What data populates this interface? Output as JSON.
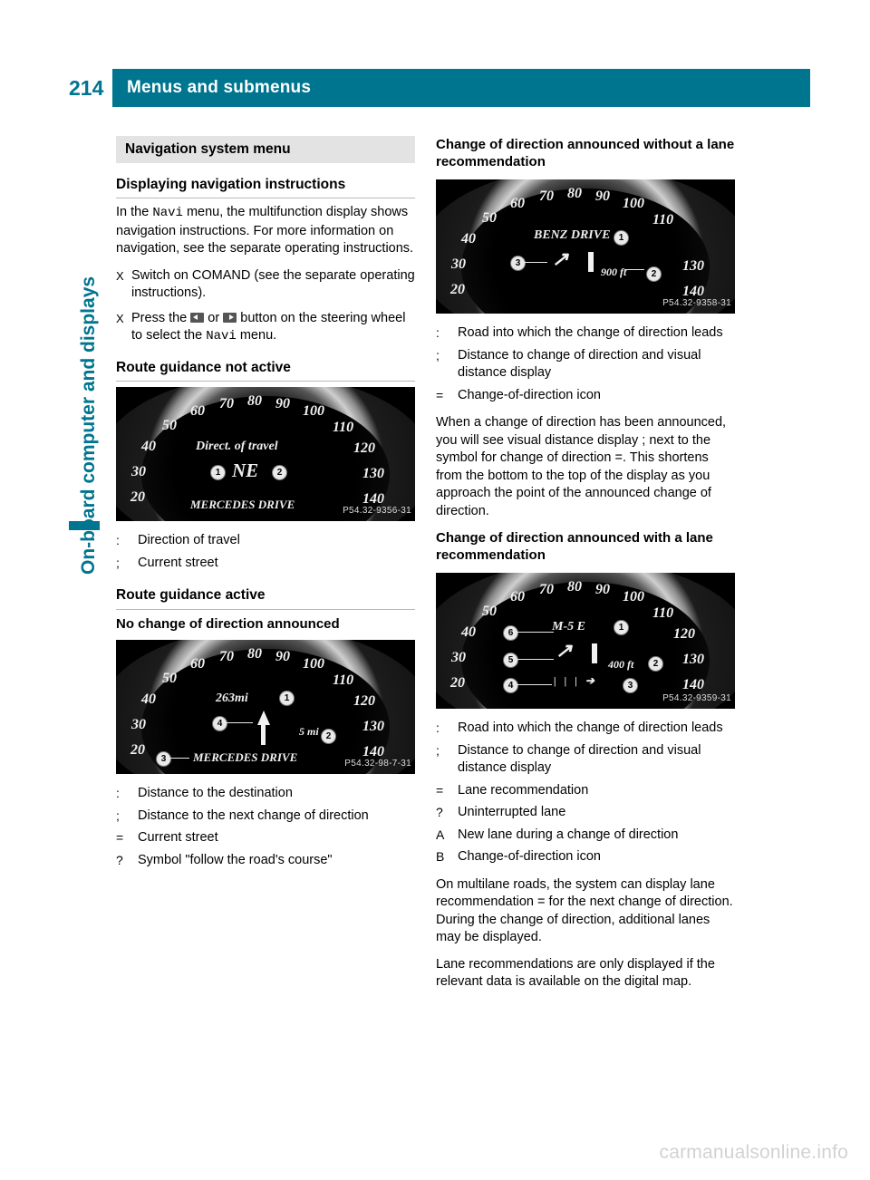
{
  "header": {
    "page_number": "214",
    "title": "Menus and submenus",
    "accent_color": "#00758f"
  },
  "side_tab": {
    "label": "On-board computer and displays"
  },
  "left_column": {
    "section_band": "Navigation system menu",
    "heading_1": "Displaying navigation instructions",
    "paragraph_1_pre": "In the ",
    "paragraph_1_mono": "Navi",
    "paragraph_1_post": " menu, the multifunction display shows navigation instructions. For more information on navigation, see the separate operating instructions.",
    "steps": [
      {
        "marker": "X",
        "text": "Switch on COMAND (see the separate operating instructions)."
      }
    ],
    "step_2_pre": "Press the ",
    "step_2_or": " or ",
    "step_2_mid": " button on the steering wheel to select the ",
    "step_2_mono": "Navi",
    "step_2_post": " menu.",
    "heading_2": "Route guidance not active",
    "figure_1": {
      "name": "instrument-cluster-direction-of-travel",
      "lcd_title": "Direct. of travel",
      "lcd_value": "NE",
      "lcd_street": "MERCEDES DRIVE",
      "part_code": "P54.32-9356-31",
      "ticks": [
        "20",
        "30",
        "40",
        "50",
        "60",
        "70",
        "80",
        "90",
        "100",
        "110",
        "120",
        "130",
        "140"
      ],
      "callouts": [
        "1",
        "2"
      ]
    },
    "legend_1": [
      {
        "marker": "1",
        "text": "Direction of travel"
      },
      {
        "marker": "2",
        "text": "Current street"
      }
    ],
    "heading_3": "Route guidance active",
    "heading_4": "No change of direction announced",
    "figure_2": {
      "name": "instrument-cluster-no-change-of-direction",
      "lcd_distance_total": "263mi",
      "lcd_distance_next": "5 mi",
      "lcd_street": "MERCEDES DRIVE",
      "part_code": "P54.32-98-7-31",
      "ticks": [
        "20",
        "30",
        "40",
        "50",
        "60",
        "70",
        "80",
        "90",
        "100",
        "110",
        "120",
        "130",
        "140"
      ],
      "callouts": [
        "1",
        "2",
        "3",
        "4"
      ]
    },
    "legend_2": [
      {
        "marker": "1",
        "text": "Distance to the destination"
      },
      {
        "marker": "2",
        "text": "Distance to the next change of direction"
      },
      {
        "marker": "3",
        "text": "Current street"
      },
      {
        "marker": "4",
        "text": "Symbol \"follow the road's course\""
      }
    ]
  },
  "right_column": {
    "heading_1": "Change of direction announced without a lane recommendation",
    "figure_3": {
      "name": "instrument-cluster-change-without-lane",
      "lcd_street": "BENZ DRIVE",
      "lcd_distance": "900 ft",
      "part_code": "P54.32-9358-31",
      "ticks": [
        "20",
        "30",
        "40",
        "50",
        "60",
        "70",
        "80",
        "90",
        "100",
        "110",
        "130",
        "140"
      ],
      "callouts": [
        "1",
        "2",
        "3"
      ]
    },
    "legend_1": [
      {
        "marker": "1",
        "text": "Road into which the change of direction leads"
      },
      {
        "marker": "2",
        "text": "Distance to change of direction and visual distance display"
      },
      {
        "marker": "3",
        "text": "Change-of-direction icon"
      }
    ],
    "paragraph_1_a": "When a change of direction has been announced, you will see visual distance display ",
    "paragraph_1_b": " next to the symbol for change of direction ",
    "paragraph_1_c": ". This shortens from the bottom to the top of the display as you approach the point of the announced change of direction.",
    "heading_2": "Change of direction announced with a lane recommendation",
    "figure_4": {
      "name": "instrument-cluster-change-with-lane",
      "lcd_street": "M-5 E",
      "lcd_distance": "400 ft",
      "part_code": "P54.32-9359-31",
      "ticks": [
        "20",
        "30",
        "40",
        "50",
        "60",
        "70",
        "80",
        "90",
        "100",
        "110",
        "120",
        "130",
        "140"
      ],
      "callouts": [
        "1",
        "2",
        "3",
        "4",
        "5",
        "6"
      ]
    },
    "legend_2": [
      {
        "marker": "1",
        "text": "Road into which the change of direction leads"
      },
      {
        "marker": "2",
        "text": "Distance to change of direction and visual distance display"
      },
      {
        "marker": "3",
        "text": "Lane recommendation"
      },
      {
        "marker": "4",
        "text": "Uninterrupted lane"
      },
      {
        "marker": "5",
        "text": "New lane during a change of direction"
      },
      {
        "marker": "6",
        "text": "Change-of-direction icon"
      }
    ],
    "paragraph_2_a": "On multilane roads, the system can display lane recommendation ",
    "paragraph_2_b": " for the next change of direction. During the change of direction, additional lanes may be displayed.",
    "paragraph_3": "Lane recommendations are only displayed if the relevant data is available on the digital map."
  },
  "watermark": "carmanualsonline.info"
}
